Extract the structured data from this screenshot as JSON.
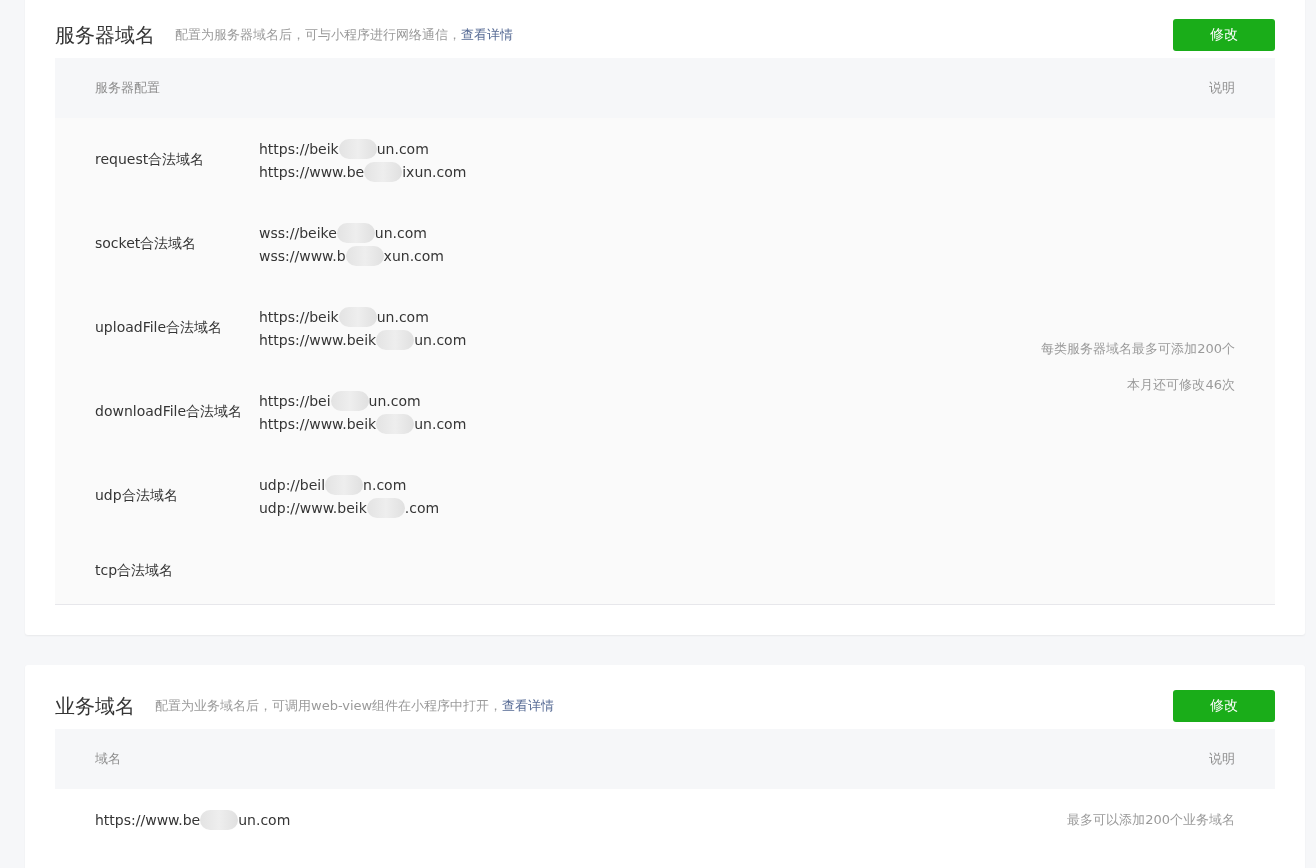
{
  "server_section": {
    "title": "服务器域名",
    "description": "配置为服务器域名后，可与小程序进行网络通信，",
    "link": "查看详情",
    "button": "修改",
    "columns": [
      "服务器配置",
      "说明"
    ],
    "rows": [
      {
        "label": "request合法域名",
        "domains": [
          {
            "before": "https://beik",
            "after": "un.com"
          },
          {
            "before": "https://www.be",
            "after": "ixun.com"
          }
        ]
      },
      {
        "label": "socket合法域名",
        "domains": [
          {
            "before": "wss://beike",
            "after": "un.com"
          },
          {
            "before": "wss://www.b",
            "after": "xun.com"
          }
        ]
      },
      {
        "label": "uploadFile合法域名",
        "domains": [
          {
            "before": "https://beik",
            "after": "un.com"
          },
          {
            "before": "https://www.beik",
            "after": "un.com"
          }
        ]
      },
      {
        "label": "downloadFile合法域名",
        "domains": [
          {
            "before": "https://bei",
            "after": "un.com"
          },
          {
            "before": "https://www.beik",
            "after": "un.com"
          }
        ]
      },
      {
        "label": "udp合法域名",
        "domains": [
          {
            "before": "udp://beil",
            "after": "n.com"
          },
          {
            "before": "udp://www.beik",
            "after": ".com"
          }
        ]
      },
      {
        "label": "tcp合法域名",
        "domains": []
      }
    ],
    "notes": [
      "每类服务器域名最多可添加200个",
      "本月还可修改46次"
    ]
  },
  "business_section": {
    "title": "业务域名",
    "description": "配置为业务域名后，可调用web-view组件在小程序中打开，",
    "link": "查看详情",
    "button": "修改",
    "columns": [
      "域名",
      "说明"
    ],
    "rows": [
      {
        "domain": {
          "before": "https://www.be",
          "after": "un.com"
        },
        "note": "最多可以添加200个业务域名"
      }
    ]
  }
}
